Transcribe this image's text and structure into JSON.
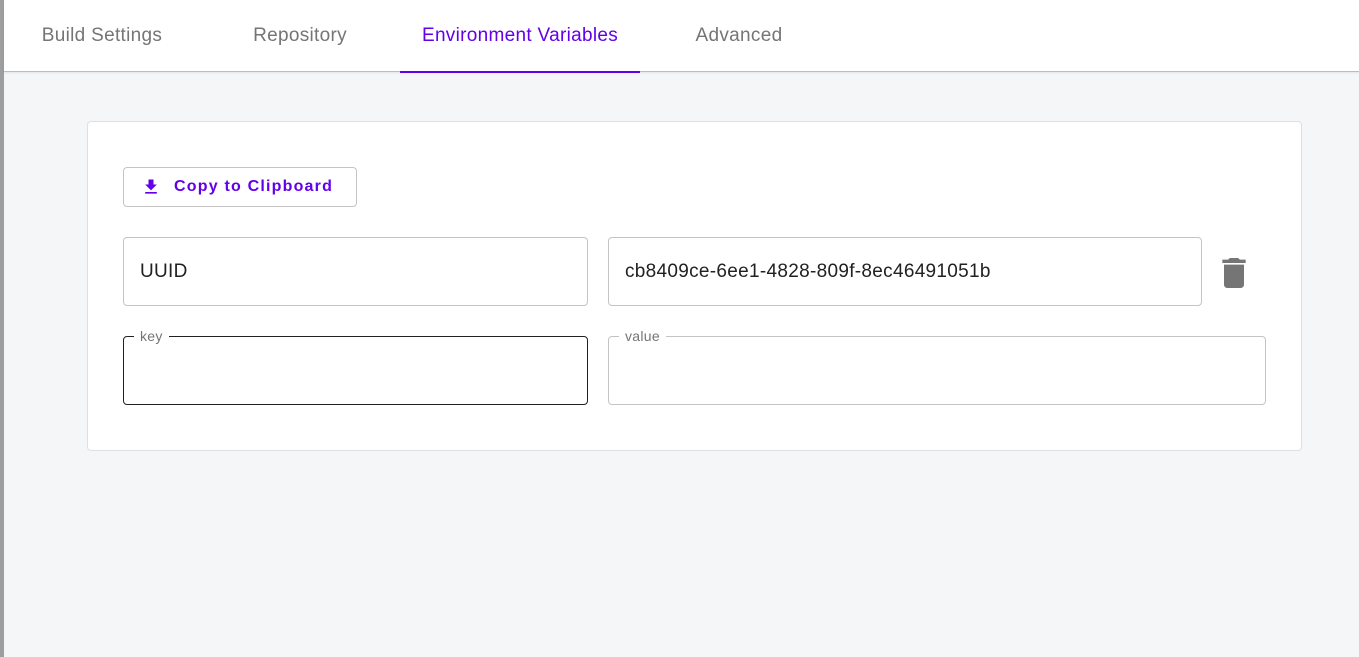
{
  "tabs": [
    {
      "label": "Build Settings",
      "active": false
    },
    {
      "label": "Repository",
      "active": false
    },
    {
      "label": "Environment Variables",
      "active": true
    },
    {
      "label": "Advanced",
      "active": false
    }
  ],
  "accent_color": "#6200ea",
  "toolbar": {
    "copy_label": "Copy to Clipboard",
    "copy_icon": "download-icon"
  },
  "env_vars": [
    {
      "key": "UUID",
      "value": "cb8409ce-6ee1-4828-809f-8ec46491051b",
      "delete_icon": "trash-icon"
    }
  ],
  "new_var": {
    "key_label": "key",
    "value_label": "value"
  }
}
